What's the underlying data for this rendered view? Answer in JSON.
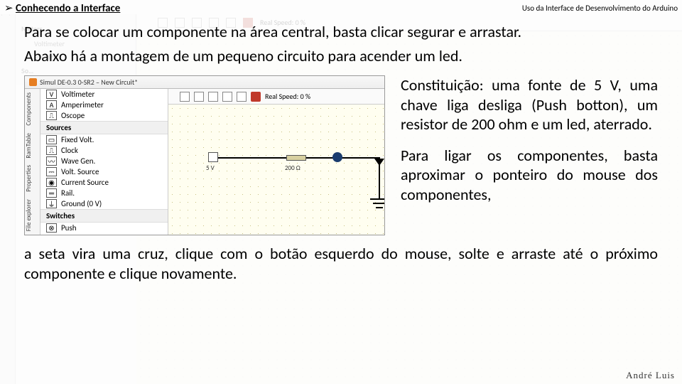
{
  "header": {
    "bullet": "➢",
    "title": "Conhecendo a Interface",
    "subtitle": "Uso da Interface de Desenvolvimento do Arduino"
  },
  "paragraphs": {
    "p1": "Para se colocar um componente na área central, basta clicar segurar e arrastar.",
    "p2": "Abaixo há a montagem de um pequeno circuito para acender um led.",
    "p3": "Constituição: uma fonte de 5 V, uma chave liga desliga (Push botton), um resistor de 200 ohm e um led, aterrado.",
    "p4": "Para ligar os componentes, basta aproximar o ponteiro do mouse dos componentes,",
    "p5": "a seta vira uma cruz, clique com o botão esquerdo do mouse, solte e arraste até o próximo componente e clique novamente."
  },
  "screenshot": {
    "window_title": "Simul DE-0.3  0-SR2 – New Circuit*",
    "tabs": {
      "t1": "Components",
      "t2": "RamTable",
      "t3": "Properties",
      "t4": "File explorer"
    },
    "toolbar": {
      "speed": "Real Speed: 0 %"
    },
    "sidebar": {
      "meters": [
        {
          "icon": "V",
          "label": "Voltimeter"
        },
        {
          "icon": "A",
          "label": "Amperimeter"
        },
        {
          "icon": "⎍",
          "label": "Oscope"
        }
      ],
      "section_sources": "Sources",
      "sources": [
        {
          "icon": "▭",
          "label": "Fixed Volt."
        },
        {
          "icon": "⎍",
          "label": "Clock"
        },
        {
          "icon": "〰",
          "label": "Wave Gen."
        },
        {
          "icon": "⎓",
          "label": "Volt. Source"
        },
        {
          "icon": "◉",
          "label": "Current Source"
        },
        {
          "icon": "═",
          "label": "Rail."
        },
        {
          "icon": "⏚",
          "label": "Ground (0 V)"
        }
      ],
      "section_switches": "Switches",
      "switches": [
        {
          "icon": "⊗",
          "label": "Push"
        }
      ]
    },
    "canvas": {
      "volt_label": "5 V",
      "res_label": "200 Ω"
    }
  },
  "bg": {
    "meters": "Meters",
    "items1": [
      "Voltimeter",
      "Oscope"
    ],
    "so": "So…",
    "speed": "Real Speed: 0 %"
  },
  "footer": {
    "author": "André Luis"
  }
}
